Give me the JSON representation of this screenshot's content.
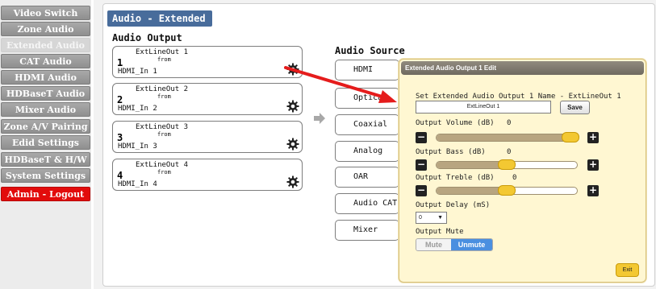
{
  "sidebar": {
    "items": [
      {
        "label": "Video Switch"
      },
      {
        "label": "Zone Audio"
      },
      {
        "label": "Extended Audio"
      },
      {
        "label": "CAT Audio"
      },
      {
        "label": "HDMI Audio"
      },
      {
        "label": "HDBaseT Audio"
      },
      {
        "label": "Mixer Audio"
      },
      {
        "label": "Zone A/V Pairing"
      },
      {
        "label": "Edid Settings"
      },
      {
        "label": "HDBaseT & H/W"
      },
      {
        "label": "System Settings"
      },
      {
        "label": "Admin - Logout"
      }
    ],
    "active_index": 2,
    "logout_color": "#e20b0b"
  },
  "page": {
    "title": "Audio - Extended"
  },
  "outputs": {
    "label": "Audio Output",
    "from_label": "from",
    "items": [
      {
        "number": "1",
        "name": "ExtLineOut 1",
        "source": "HDMI_In 1"
      },
      {
        "number": "2",
        "name": "ExtLineOut 2",
        "source": "HDMI_In 2"
      },
      {
        "number": "3",
        "name": "ExtLineOut 3",
        "source": "HDMI_In 3"
      },
      {
        "number": "4",
        "name": "ExtLineOut 4",
        "source": "HDMI_In 4"
      }
    ]
  },
  "sources": {
    "label": "Audio Source",
    "items": [
      {
        "label": "HDMI"
      },
      {
        "label": "Optical"
      },
      {
        "label": "Coaxial"
      },
      {
        "label": "Analog"
      },
      {
        "label": "OAR"
      },
      {
        "label": "Audio CAT"
      },
      {
        "label": "Mixer"
      }
    ]
  },
  "dialog": {
    "title": "Extended Audio Output 1 Edit",
    "name_label": "Set Extended Audio Output 1 Name - ExtLineOut 1",
    "name_value": "ExtLineOut 1",
    "save_label": "Save",
    "volume": {
      "label": "Output Volume (dB)",
      "value": "0",
      "level": 0.95
    },
    "bass": {
      "label": "Output Bass (dB)",
      "value": "0",
      "level": 0.5
    },
    "treble": {
      "label": "Output Treble (dB)",
      "value": "0",
      "level": 0.5
    },
    "delay": {
      "label": "Output Delay (mS)",
      "value": "0"
    },
    "mute": {
      "label": "Output Mute",
      "mute_label": "Mute",
      "unmute_label": "Unmute",
      "selected": "Unmute"
    },
    "exit_label": "Exit",
    "accent": "#f3c832",
    "selected_color": "#4a8fe0"
  },
  "icons": {
    "gear": "gear-icon",
    "arrow": "arrow-right-icon",
    "annotation": "red-pointer-arrow"
  }
}
